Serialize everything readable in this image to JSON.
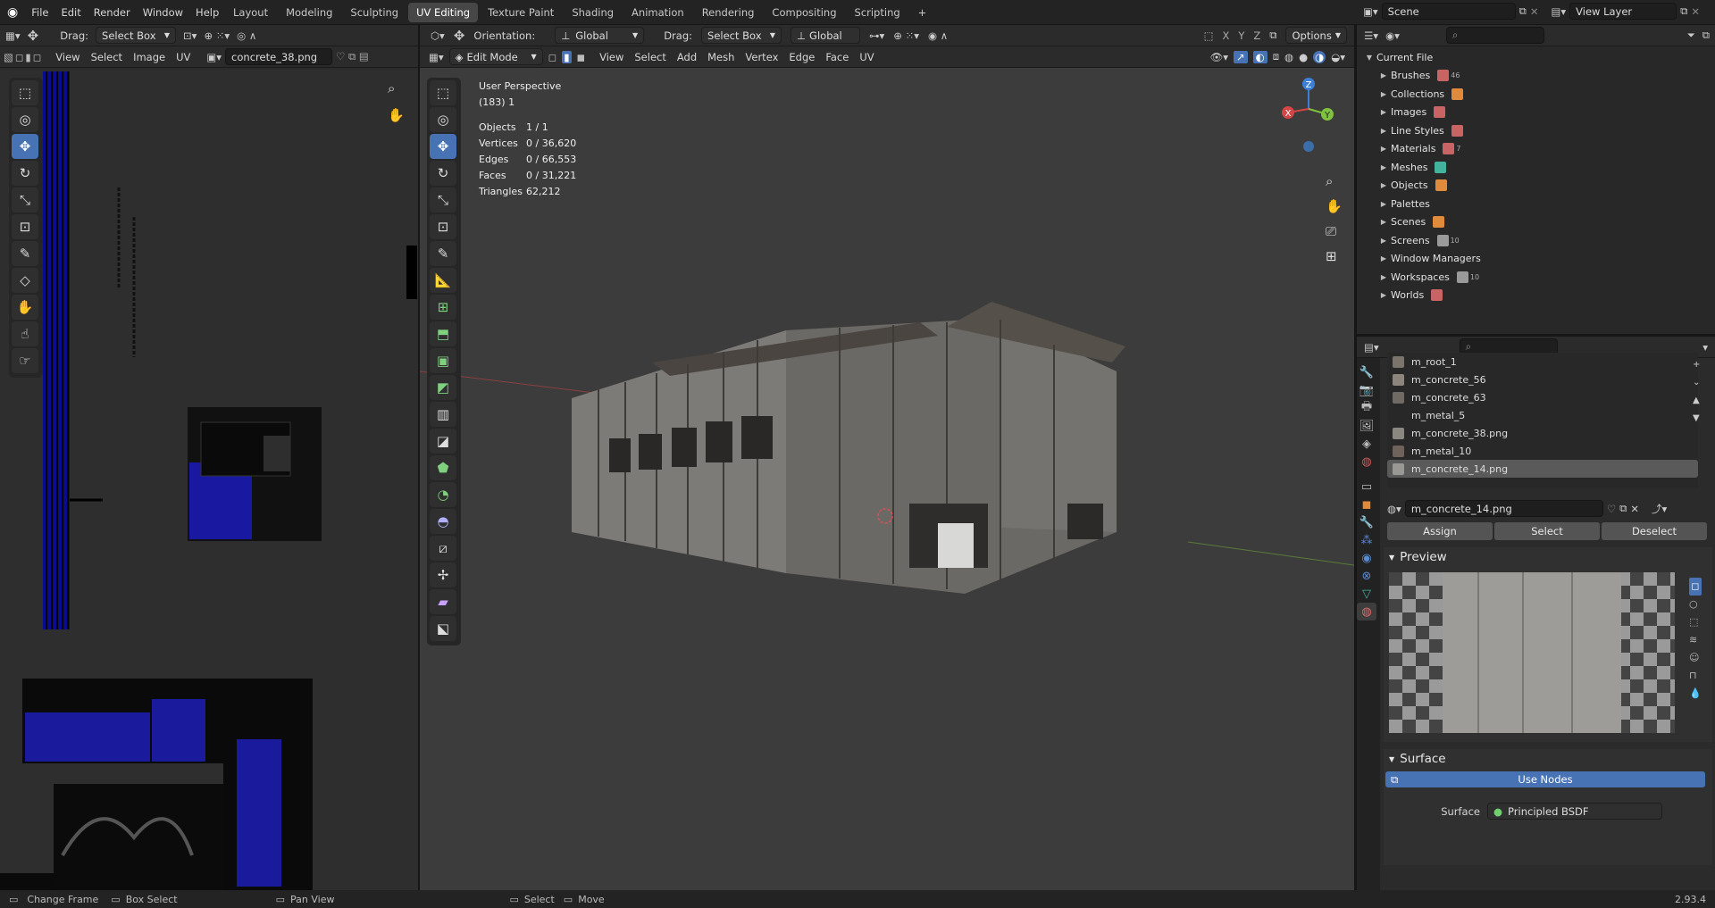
{
  "menus": [
    "File",
    "Edit",
    "Render",
    "Window",
    "Help"
  ],
  "workspace_tabs": [
    "Layout",
    "Modeling",
    "Sculpting",
    "UV Editing",
    "Texture Paint",
    "Shading",
    "Animation",
    "Rendering",
    "Compositing",
    "Scripting"
  ],
  "active_tab": "UV Editing",
  "scene": {
    "name": "Scene",
    "view_layer": "View Layer"
  },
  "uv_editor": {
    "drag_label": "Drag:",
    "drag_value": "Select Box",
    "menus": [
      "View",
      "Select",
      "Image",
      "UV"
    ],
    "image_name": "concrete_38.png"
  },
  "viewport": {
    "mode": "Edit Mode",
    "orientation_label": "Orientation:",
    "orientation_value": "Global",
    "drag_label": "Drag:",
    "drag_value": "Select Box",
    "transform_value": "Global",
    "options": "Options",
    "menus": [
      "View",
      "Select",
      "Add",
      "Mesh",
      "Vertex",
      "Edge",
      "Face",
      "UV"
    ],
    "axes": [
      "X",
      "Y",
      "Z"
    ],
    "perspective": "User Perspective",
    "frame_info": "(183) 1",
    "stats": [
      {
        "label": "Objects",
        "value": "1 / 1"
      },
      {
        "label": "Vertices",
        "value": "0 / 36,620"
      },
      {
        "label": "Edges",
        "value": "0 / 66,553"
      },
      {
        "label": "Faces",
        "value": "0 / 31,221"
      },
      {
        "label": "Triangles",
        "value": "62,212"
      }
    ],
    "gizmo": {
      "x": "X",
      "y": "Y",
      "z": "Z"
    }
  },
  "outliner": {
    "root": "Current File",
    "items": [
      {
        "label": "Brushes",
        "badge": "46",
        "color": "#c96464"
      },
      {
        "label": "Collections",
        "badge": "",
        "color": "#e08a3c"
      },
      {
        "label": "Images",
        "badge": "",
        "color": "#c96464"
      },
      {
        "label": "Line Styles",
        "badge": "",
        "color": "#c96464"
      },
      {
        "label": "Materials",
        "badge": "7",
        "color": "#c96464"
      },
      {
        "label": "Meshes",
        "badge": "",
        "color": "#43b39d"
      },
      {
        "label": "Objects",
        "badge": "",
        "color": "#e08a3c"
      },
      {
        "label": "Palettes",
        "badge": "",
        "color": ""
      },
      {
        "label": "Scenes",
        "badge": "",
        "color": "#e08a3c"
      },
      {
        "label": "Screens",
        "badge": "10",
        "color": "#9a9a9a"
      },
      {
        "label": "Window Managers",
        "badge": "",
        "color": ""
      },
      {
        "label": "Workspaces",
        "badge": "10",
        "color": "#9a9a9a"
      },
      {
        "label": "Worlds",
        "badge": "",
        "color": "#c96464"
      }
    ]
  },
  "properties": {
    "material_slots": [
      {
        "name": "m_root_1",
        "swatch": "#7b746a"
      },
      {
        "name": "m_concrete_56",
        "swatch": "#8b857c"
      },
      {
        "name": "m_concrete_63",
        "swatch": "#6f6a64"
      },
      {
        "name": "m_metal_5",
        "swatch": ""
      },
      {
        "name": "m_concrete_38.png",
        "swatch": "#8a8780"
      },
      {
        "name": "m_metal_10",
        "swatch": "#6e625a"
      },
      {
        "name": "m_concrete_14.png",
        "swatch": "#9a9894"
      }
    ],
    "active_slot": "m_concrete_14.png",
    "material_name": "m_concrete_14.png",
    "buttons": {
      "assign": "Assign",
      "select": "Select",
      "deselect": "Deselect"
    },
    "preview_title": "Preview",
    "surface_title": "Surface",
    "use_nodes": "Use Nodes",
    "surface_label": "Surface",
    "surface_value": "Principled BSDF"
  },
  "status_bar": {
    "items": [
      "Change Frame",
      "Box Select",
      "Pan View",
      "Select",
      "Move"
    ],
    "version": "2.93.4"
  }
}
